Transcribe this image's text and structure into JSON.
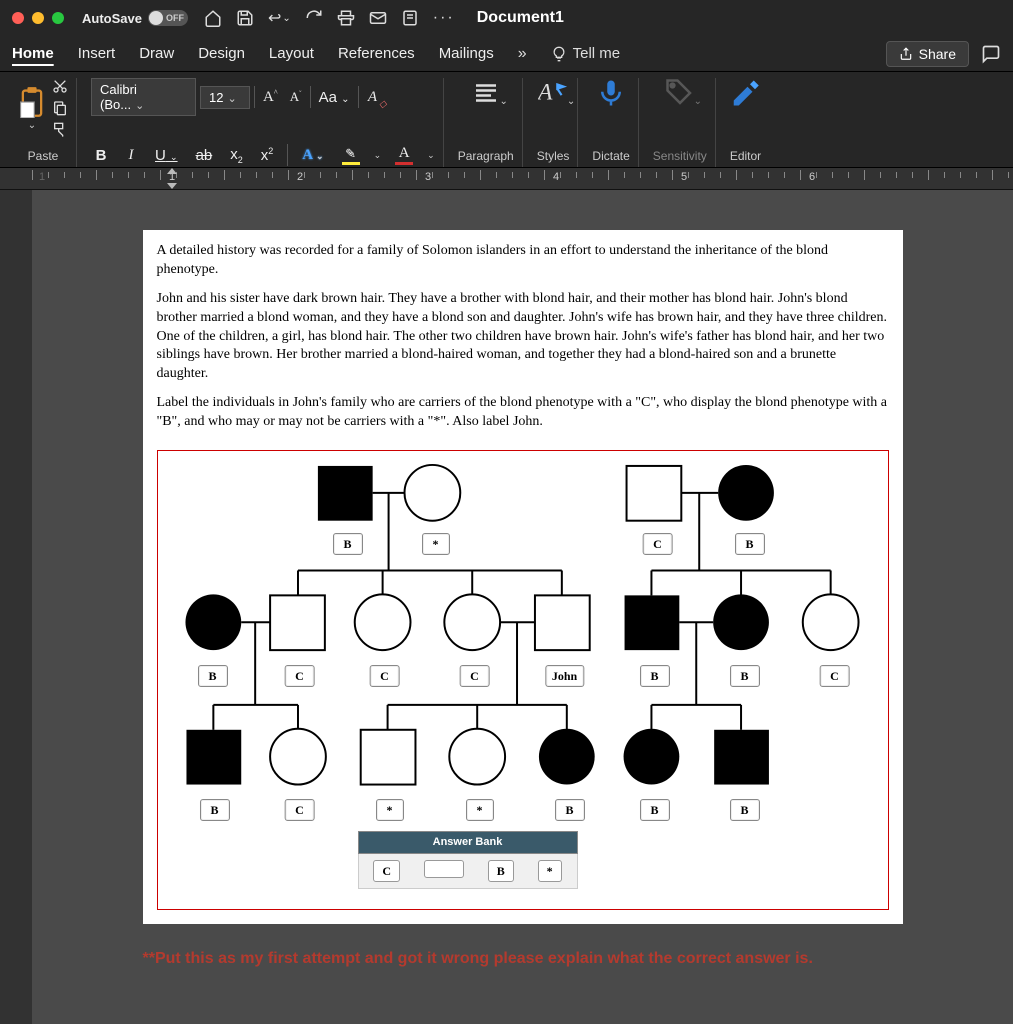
{
  "titlebar": {
    "autosave_label": "AutoSave",
    "autosave_state": "OFF",
    "doc_title": "Document1"
  },
  "tabs": {
    "items": [
      "Home",
      "Insert",
      "Draw",
      "Design",
      "Layout",
      "References",
      "Mailings"
    ],
    "active_index": 0,
    "more_glyph": "»",
    "tell_me": "Tell me",
    "share": "Share"
  },
  "ribbon": {
    "paste": "Paste",
    "font_name": "Calibri (Bo...",
    "font_size": "12",
    "bold": "B",
    "italic": "I",
    "underline": "U",
    "strike": "ab",
    "subscript": "x₂",
    "superscript": "x²",
    "inc_font": "A^",
    "dec_font": "A˘",
    "case": "Aa",
    "clear": "A⊘",
    "text_effects": "A",
    "highlight": "✎",
    "font_color": "A",
    "paragraph": "Paragraph",
    "styles": "Styles",
    "dictate": "Dictate",
    "sensitivity": "Sensitivity",
    "editor": "Editor"
  },
  "ruler": {
    "numbers": [
      "1",
      "1",
      "2",
      "3",
      "4",
      "5",
      "6"
    ]
  },
  "document": {
    "p1": "A detailed history was recorded for a family of Solomon islanders in an effort to understand the inheritance of the blond phenotype.",
    "p2": "John and his sister have dark brown hair. They have a brother with blond hair, and their mother has blond hair. John's blond brother married a blond woman, and they have a blond son and daughter. John's wife has brown hair, and they have three children. One of the children, a girl, has blond hair. The other two children have brown hair. John's wife's father has blond hair, and her two siblings have brown. Her brother married a blond-haired woman, and together they had a blond-haired son and a brunette daughter.",
    "p3": "Label the individuals in John's family who are carriers of the blond phenotype with a \"C\", who display the blond phenotype with a \"B\", and who may or may not be carriers with a \"*\". Also label John."
  },
  "pedigree": {
    "labels": {
      "g1_l1": "B",
      "g1_l2": "*",
      "g1_r1": "C",
      "g1_r2": "B",
      "g2_1": "B",
      "g2_2": "C",
      "g2_3": "C",
      "g2_4": "C",
      "g2_5": "John",
      "g2_6": "B",
      "g2_7": "B",
      "g2_8": "C",
      "g3_1": "B",
      "g3_2": "C",
      "g3_3": "*",
      "g3_4": "*",
      "g3_5": "B",
      "g3_6": "B",
      "g3_7": "B"
    },
    "answer_bank": {
      "title": "Answer Bank",
      "cells": [
        "C",
        "",
        "B",
        "*"
      ]
    }
  },
  "annotation": {
    "prefix": "**Put this as my first attempt and got it ",
    "bold": "wrong",
    "suffix": " please explain what the correct answer is."
  },
  "colors": {
    "accent_blue": "#2e7cd6",
    "highlight_yellow": "#ffeb3b",
    "font_color_red": "#d32f2f",
    "annotation_red": "#b43a2e"
  }
}
